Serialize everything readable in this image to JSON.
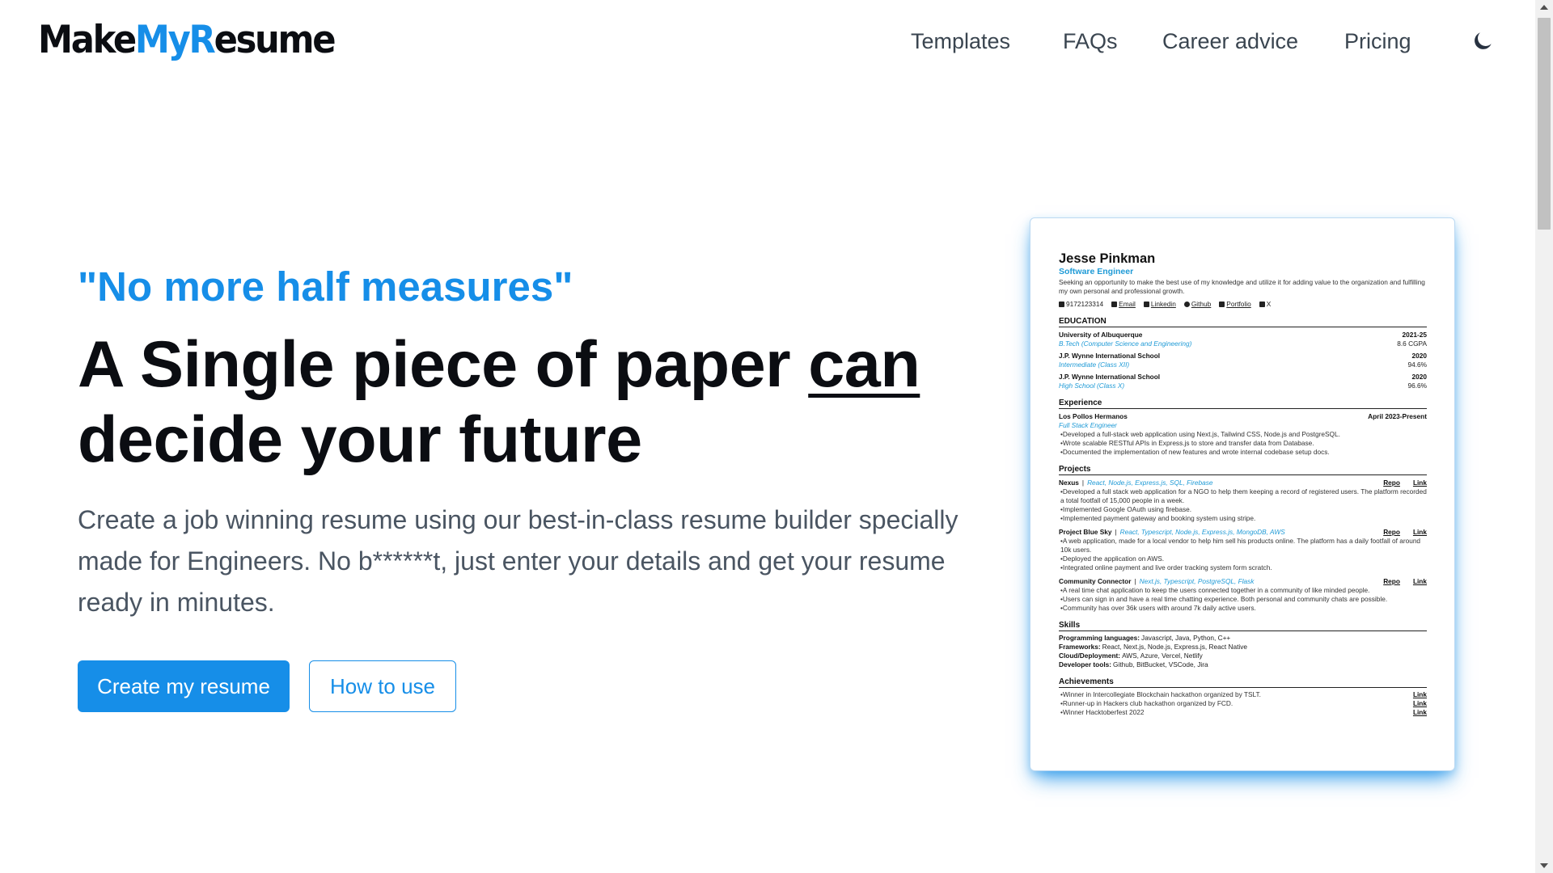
{
  "header": {
    "logo": {
      "part1": "Make",
      "part2": "My",
      "part3": "R",
      "part4": "esume"
    },
    "nav": [
      "Templates",
      "FAQs",
      "Career advice",
      "Pricing"
    ],
    "theme_toggle_icon": "moon-icon"
  },
  "hero": {
    "tagline": "\"No more half measures\"",
    "headline_part1": "A Single piece of paper ",
    "headline_emphasis": "can",
    "headline_part2": " decide your future",
    "subtext": "Create a job winning resume using our best-in-class resume builder specially made for Engineers. No b******t, just enter your details and get your resume ready in minutes.",
    "primary_button": "Create my resume",
    "secondary_button": "How to use"
  },
  "resume_preview": {
    "name": "Jesse Pinkman",
    "role": "Software Engineer",
    "summary": "Seeking an opportunity to make the best use of my knowledge and utilize it for adding value to the organization and fulfilling my own personal and professional growth.",
    "contacts": [
      "9172123314",
      "Email",
      "Linkedin",
      "Github",
      "Portfolio",
      "X"
    ],
    "sections": {
      "education": "EDUCATION",
      "experience": "Experience",
      "projects": "Projects",
      "skills": "Skills",
      "achievements": "Achievements"
    },
    "education": [
      {
        "school": "University of Albuquerque",
        "year": "2021-25",
        "degree": "B.Tech (Computer Science and Engineering)",
        "score": "8.6 CGPA"
      },
      {
        "school": "J.P. Wynne International School",
        "year": "2020",
        "degree": "Intermediate (Class XII)",
        "score": "94.6%"
      },
      {
        "school": "J.P. Wynne International School",
        "year": "2020",
        "degree": "High School (Class X)",
        "score": "96.6%"
      }
    ],
    "experience": [
      {
        "company": "Los Pollos Hermanos",
        "date": "April 2023-Present",
        "title": "Full Stack Engineer",
        "bullets": [
          "•Developed a full-stack web application using Next.js, Tailwind CSS, Node.js and PostgreSQL.",
          "•Wrote scalable RESTful APIs in Express.js to store and transfer data from Database.",
          "•Documented the implementation of new features and wrote internal codebase setup docs."
        ]
      }
    ],
    "projects": [
      {
        "name": "Nexus",
        "stack": "React, Node.js, Express.js, SQL, Firebase",
        "bullets": [
          "•Developed a full stack web application for a NGO to help them keeping a record of registered users. The platform recorded a total footfall of 15,000 people in a week.",
          "•Implemented Google OAuth using firebase.",
          "•Implemented payment gateway and booking system using stripe."
        ]
      },
      {
        "name": "Project Blue Sky",
        "stack": "React, Typescript, Node.js, Express.js, MongoDB, AWS",
        "bullets": [
          "•A web application, made for a local vendor to help him sell his products online. The platform has a daily footfall of around 10k users.",
          "•Deployed the application on AWS.",
          "•Integrated online payment and live order tracking system form scratch."
        ]
      },
      {
        "name": "Community Connector",
        "stack": "Next.js, Typescript, PostgreSQL, Flask",
        "bullets": [
          "•A real time chat application to keep the users connected together in a community of like minded people.",
          "•Users can sign in and have a real time chatting experience. Both personal and community chats are possible.",
          "•Community has over 36k users with around 7k daily active users."
        ]
      }
    ],
    "project_links": {
      "repo": "Repo",
      "link": "Link"
    },
    "skills": [
      {
        "label": "Programming languages:",
        "value": "Javascript, Java, Python, C++"
      },
      {
        "label": "Frameworks:",
        "value": "React, Next.js, Node.js, Express.js, React Native"
      },
      {
        "label": "Cloud/Deployment:",
        "value": "AWS, Azure, Vercel, Netlify"
      },
      {
        "label": "Developer tools:",
        "value": "Github, BitBucket, VSCode, Jira"
      }
    ],
    "achievements": [
      {
        "text": "•Winner in Intercollegiate Blockchain hackathon organized by TSLT.",
        "link": "Link"
      },
      {
        "text": "•Runner-up in Hackers club hackathon organized by FCD.",
        "link": "Link"
      },
      {
        "text": "•Winner Hacktoberfest 2022",
        "link": "Link"
      }
    ]
  },
  "colors": {
    "accent": "#168ee8",
    "text_dark": "#0b0d12",
    "text_muted": "#4a5562"
  }
}
